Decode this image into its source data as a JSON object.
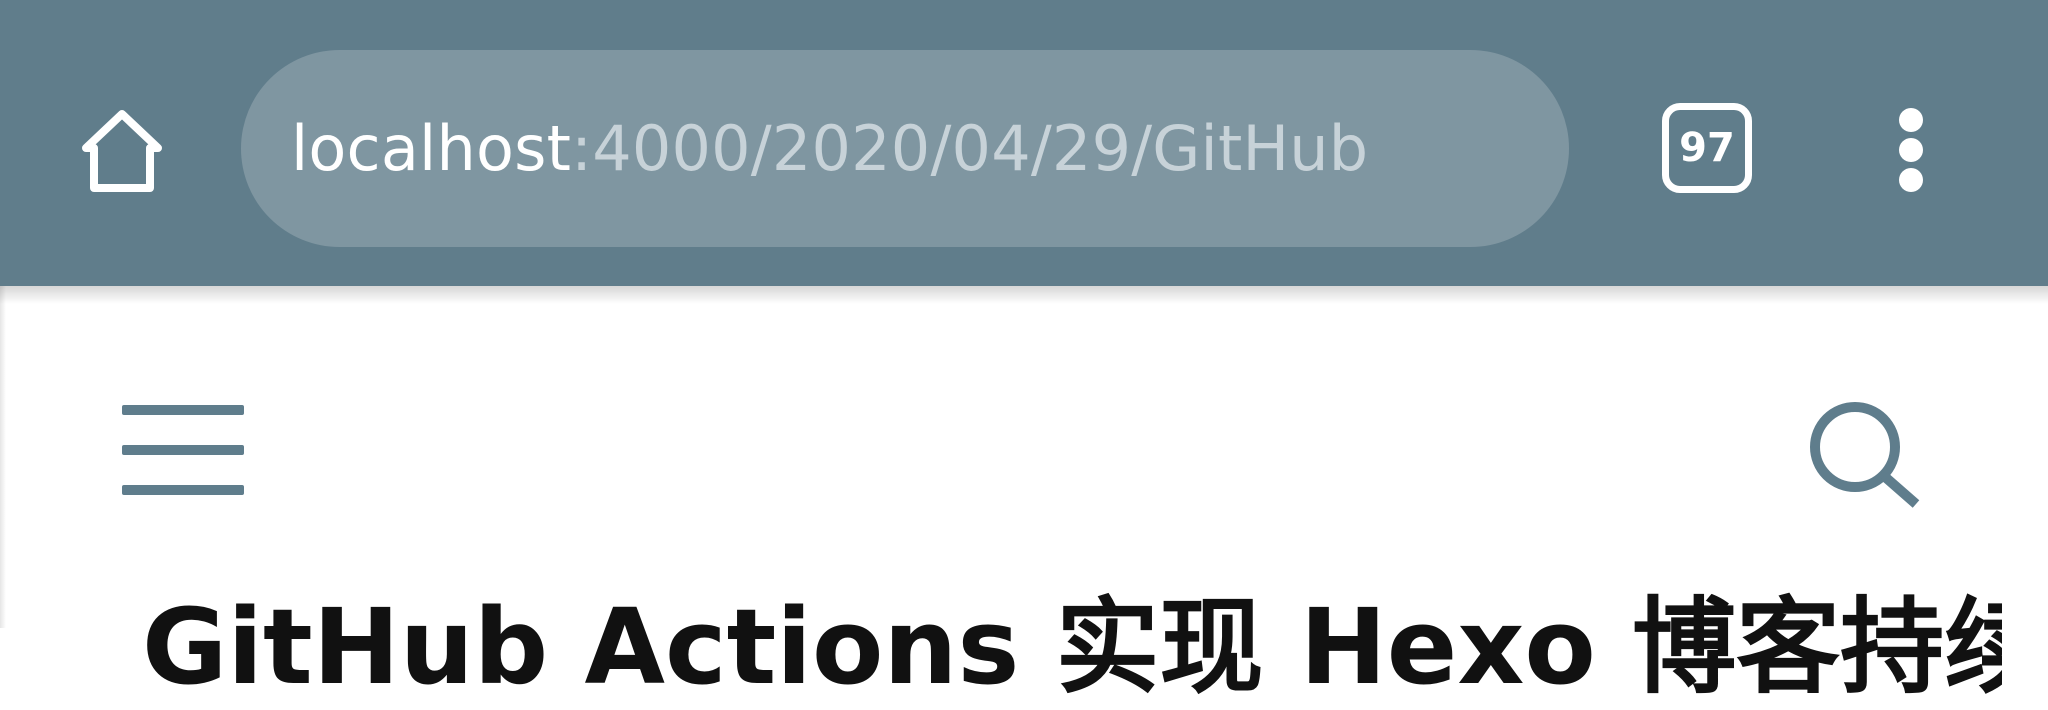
{
  "browser": {
    "url_host": "localhost",
    "url_path": ":4000/2020/04/29/GitHub",
    "tab_count": "97",
    "colors": {
      "toolbar": "#607d8b",
      "url_pill": "#7f96a1",
      "url_host_text": "#ffffff",
      "url_path_text": "#c7d2d8"
    },
    "icons": [
      "home-icon",
      "tabs-icon",
      "more-vert-icon"
    ]
  },
  "page": {
    "title": "GitHub Actions 实现 Hexo 博客持续",
    "icons": [
      "menu-icon",
      "search-icon"
    ],
    "accent_color": "#5f7d8c"
  }
}
